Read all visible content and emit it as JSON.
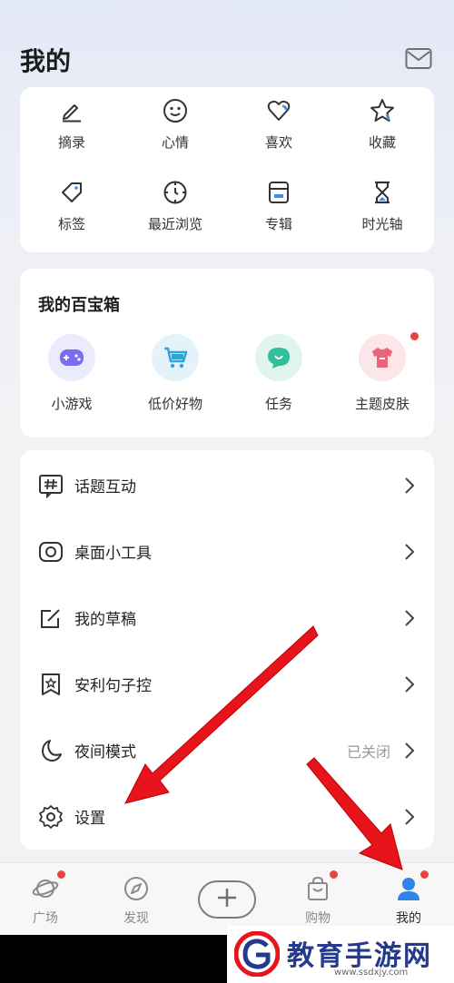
{
  "header": {
    "title": "我的",
    "mail_icon": "mail-icon"
  },
  "quick_actions": [
    {
      "label": "摘录",
      "icon": "pencil-icon"
    },
    {
      "label": "心情",
      "icon": "smile-icon"
    },
    {
      "label": "喜欢",
      "icon": "heart-icon"
    },
    {
      "label": "收藏",
      "icon": "star-icon"
    },
    {
      "label": "标签",
      "icon": "tag-icon"
    },
    {
      "label": "最近浏览",
      "icon": "clock-icon"
    },
    {
      "label": "专辑",
      "icon": "album-icon"
    },
    {
      "label": "时光轴",
      "icon": "hourglass-icon"
    }
  ],
  "treasure_box": {
    "title": "我的百宝箱",
    "items": [
      {
        "label": "小游戏",
        "icon": "gamepad-icon",
        "color": "#7a6ef0",
        "bg": "#ecebfb"
      },
      {
        "label": "低价好物",
        "icon": "cart-icon",
        "color": "#2aa7d6",
        "bg": "#e3f3f9"
      },
      {
        "label": "任务",
        "icon": "chat-icon",
        "color": "#2fc09a",
        "bg": "#e0f5ee"
      },
      {
        "label": "主题皮肤",
        "icon": "shirt-icon",
        "color": "#e8657a",
        "bg": "#fbe6ea",
        "badge": true
      }
    ]
  },
  "menu": [
    {
      "label": "话题互动",
      "icon": "hashtag-icon",
      "value": ""
    },
    {
      "label": "桌面小工具",
      "icon": "widget-icon",
      "value": ""
    },
    {
      "label": "我的草稿",
      "icon": "draft-icon",
      "value": ""
    },
    {
      "label": "安利句子控",
      "icon": "bookmark-star-icon",
      "value": ""
    },
    {
      "label": "夜间模式",
      "icon": "moon-icon",
      "value": "已关闭"
    },
    {
      "label": "设置",
      "icon": "gear-icon",
      "value": ""
    }
  ],
  "tabbar": {
    "tabs": [
      {
        "label": "广场",
        "icon": "planet-icon",
        "badge": true,
        "active": false
      },
      {
        "label": "发现",
        "icon": "compass-icon",
        "badge": false,
        "active": false
      },
      {
        "label": "购物",
        "icon": "bag-icon",
        "badge": true,
        "active": false
      },
      {
        "label": "我的",
        "icon": "user-icon",
        "badge": true,
        "active": true
      }
    ],
    "add_icon": "plus-icon"
  },
  "watermark": {
    "text": "教育手游网",
    "url": "www.ssdxjy.com"
  },
  "colors": {
    "accent": "#2f86e6",
    "badge": "#e5473f",
    "arrow": "#e8141b"
  }
}
